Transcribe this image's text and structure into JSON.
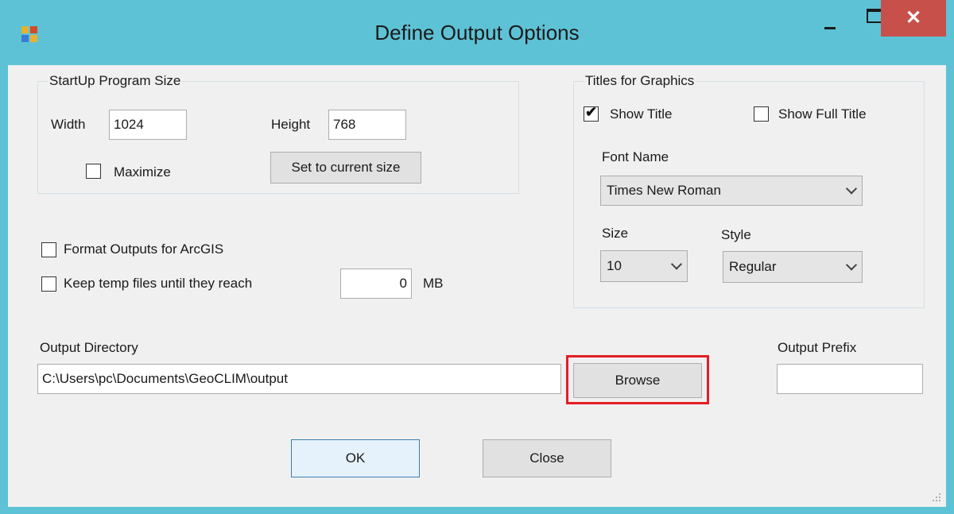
{
  "window": {
    "title": "Define Output Options",
    "controls": {
      "minimize_icon": "minimize-icon",
      "maximize_icon": "maximize-icon",
      "close_glyph": "✕"
    }
  },
  "startup": {
    "group_title": "StartUp Program Size",
    "width_label": "Width",
    "width_value": "1024",
    "height_label": "Height",
    "height_value": "768",
    "maximize_label": "Maximize",
    "maximize_checked": false,
    "set_size_button": "Set to current size"
  },
  "options": {
    "arcgis_label": "Format Outputs for ArcGIS",
    "arcgis_checked": false,
    "temp_label": "Keep temp files until they reach",
    "temp_checked": false,
    "temp_value": "0",
    "temp_unit": "MB"
  },
  "titles": {
    "group_title": "Titles for Graphics",
    "show_title_label": "Show Title",
    "show_title_checked": true,
    "show_full_title_label": "Show Full Title",
    "show_full_title_checked": false,
    "font_name_label": "Font Name",
    "font_name_value": "Times New Roman",
    "size_label": "Size",
    "size_value": "10",
    "style_label": "Style",
    "style_value": "Regular"
  },
  "output": {
    "directory_label": "Output Directory",
    "directory_value": "C:\\Users\\pc\\Documents\\GeoCLIM\\output",
    "browse_button": "Browse",
    "prefix_label": "Output Prefix",
    "prefix_value": ""
  },
  "footer": {
    "ok_button": "OK",
    "close_button": "Close"
  },
  "colors": {
    "titlebar": "#5ec2d6",
    "close_button": "#c7504a",
    "highlight": "#e41e26"
  }
}
